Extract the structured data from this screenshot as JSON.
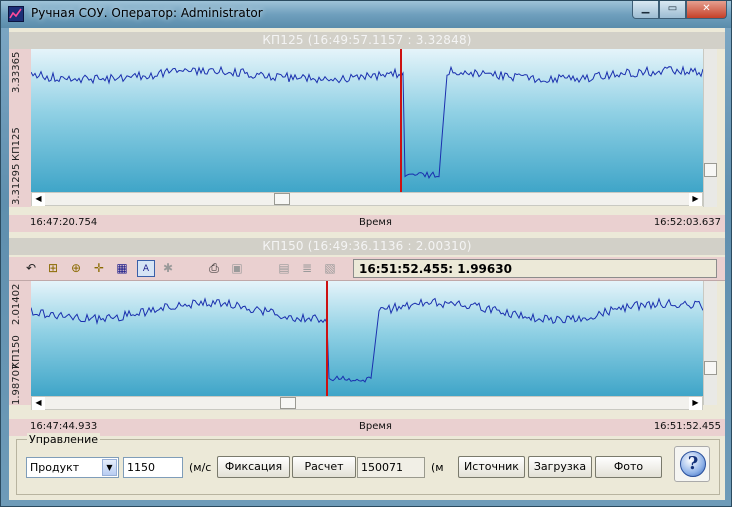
{
  "window": {
    "title": "Ручная СОУ. Оператор: Administrator",
    "min_glyph": "▁",
    "max_glyph": "▭",
    "close_glyph": "✕"
  },
  "charts": [
    {
      "title": "КП125 (16:49:57.1157 : 3.32848)",
      "y_top": "3.33365",
      "y_mid": "КП125",
      "y_bottom": "3.31295",
      "x_start": "16:47:20.754",
      "x_label": "Время",
      "x_end": "16:52:03.637",
      "cursor_fraction": 0.55,
      "cursor_color": "#cc1111",
      "line_color": "#1a2fae"
    },
    {
      "title": "КП150 (16:49:36.1136 : 2.00310)",
      "y_top": "2.01402",
      "y_mid": "КП150",
      "y_bottom": "1.98707",
      "x_start": "16:47:44.933",
      "x_label": "Время",
      "x_end": "16:51:52.455",
      "cursor_fraction": 0.44,
      "cursor_color": "#cc1111",
      "line_color": "#1a2fae"
    }
  ],
  "toolbar": {
    "readout": "16:51:52.455: 1.99630",
    "icons": [
      "undo-icon",
      "zoom-fit-icon",
      "pan-icon",
      "crosshair-icon",
      "grid-icon",
      "auto-scale-icon",
      "settings-icon",
      "print-icon",
      "save-icon",
      "chart-icon",
      "list-icon",
      "folder-icon"
    ]
  },
  "controls": {
    "group_label": "Управление",
    "product_value": "Продукт",
    "speed_value": "1150",
    "speed_unit": "(м/с",
    "fix_button": "Фиксация",
    "calc_button": "Расчет",
    "distance_value": "150071",
    "distance_unit": "(м",
    "source_button": "Источник",
    "load_button": "Загрузка",
    "photo_button": "Фото",
    "help_glyph": "?"
  },
  "colors": {
    "accent": "#cc1111",
    "series": "#1a2fae",
    "panel_bg": "#ead0d0"
  }
}
